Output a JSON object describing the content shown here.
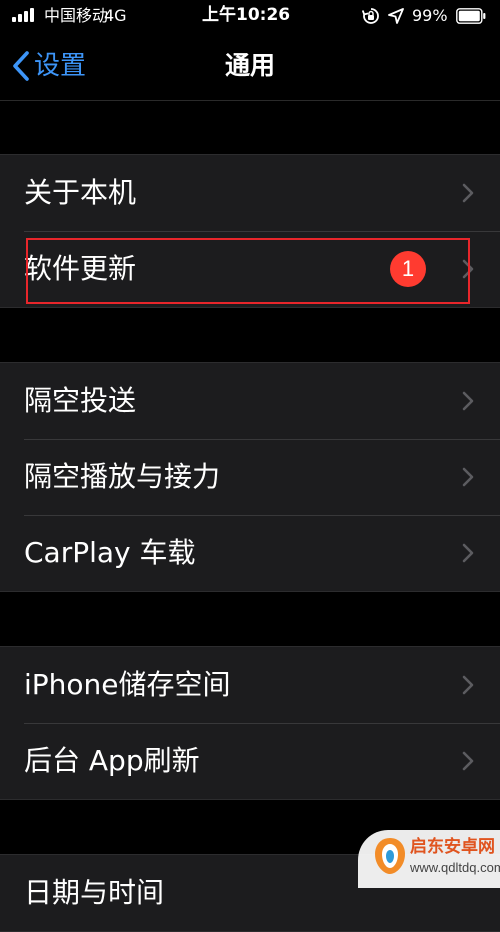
{
  "status_bar": {
    "carrier": "中国移动",
    "network": "4G",
    "time": "上午10:26",
    "battery_percent": "99%",
    "icons": [
      "signal-icon",
      "orientation-lock-icon",
      "location-icon",
      "battery-icon"
    ]
  },
  "nav": {
    "back_label": "设置",
    "title": "通用",
    "accent_color": "#3d95f8"
  },
  "sections": [
    {
      "rows": [
        {
          "label": "关于本机"
        },
        {
          "label": "软件更新",
          "badge": "1"
        }
      ]
    },
    {
      "rows": [
        {
          "label": "隔空投送"
        },
        {
          "label": "隔空播放与接力"
        },
        {
          "label": "CarPlay 车载"
        }
      ]
    },
    {
      "rows": [
        {
          "label": "iPhone储存空间"
        },
        {
          "label": "后台 App刷新"
        }
      ]
    },
    {
      "rows": [
        {
          "label": "日期与时间"
        }
      ]
    }
  ],
  "watermark": {
    "title": "启东安卓网",
    "url": "www.qdltdq.com"
  },
  "colors": {
    "badge": "#ff3b30",
    "highlight_box": "#e8262b",
    "row_background": "#1c1c1e",
    "page_background": "#000000"
  }
}
